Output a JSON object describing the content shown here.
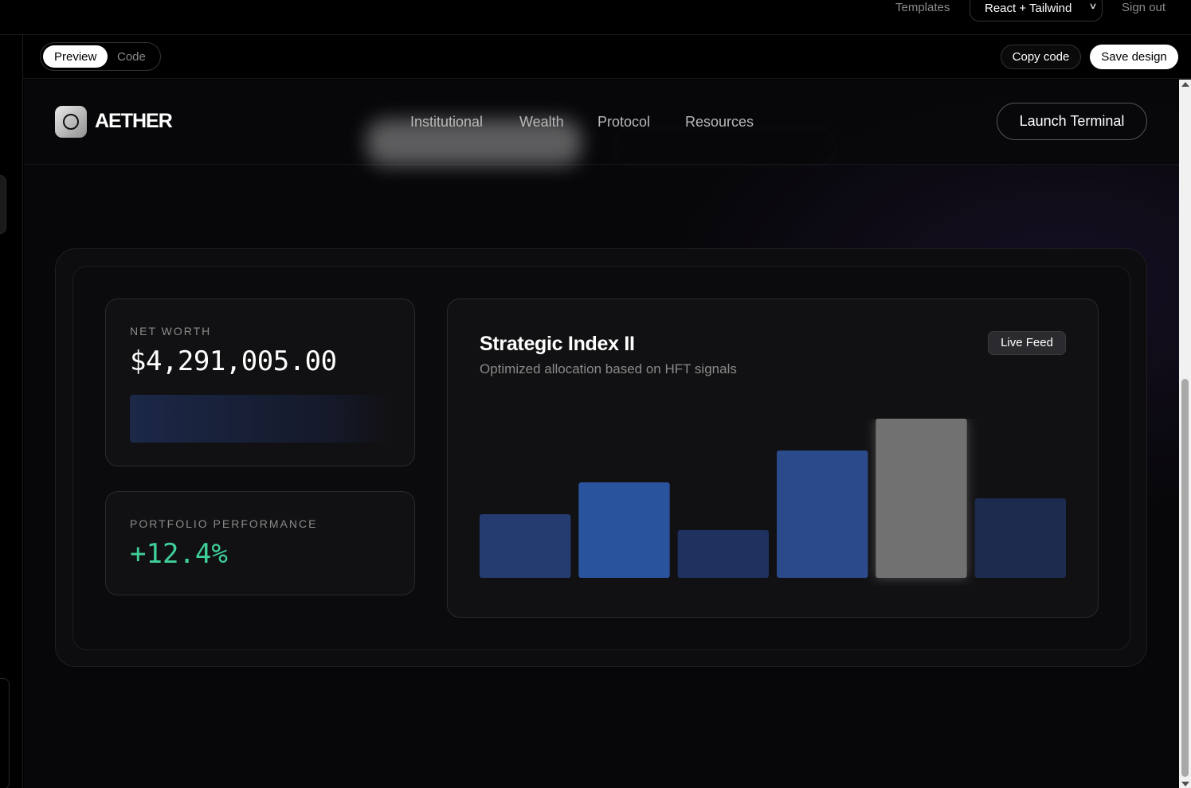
{
  "app": {
    "templates_label": "Templates",
    "framework_label": "React + Tailwind",
    "signout_label": "Sign out",
    "toggle": {
      "preview_label": "Preview",
      "code_label": "Code"
    },
    "copy_label": "Copy code",
    "save_label": "Save design"
  },
  "site": {
    "brand": "AETHER",
    "nav": [
      "Institutional",
      "Wealth",
      "Protocol",
      "Resources"
    ],
    "cta_label": "Launch Terminal"
  },
  "cards": {
    "net_worth": {
      "label": "NET WORTH",
      "value": "$4,291,005.00"
    },
    "performance": {
      "label": "PORTFOLIO PERFORMANCE",
      "value": "+12.4%"
    }
  },
  "chart_card": {
    "title": "Strategic Index II",
    "subtitle": "Optimized allocation based on HFT signals",
    "badge": "Live Feed"
  },
  "chart_data": {
    "type": "bar",
    "title": "Strategic Index II",
    "values": [
      40,
      60,
      30,
      80,
      100,
      50
    ],
    "ylim": [
      0,
      100
    ],
    "colors": [
      "#243c70",
      "#2a539e",
      "#1f315e",
      "#2b4a8a",
      "#717171",
      "#1b2a4d"
    ],
    "highlight_index": 4
  }
}
